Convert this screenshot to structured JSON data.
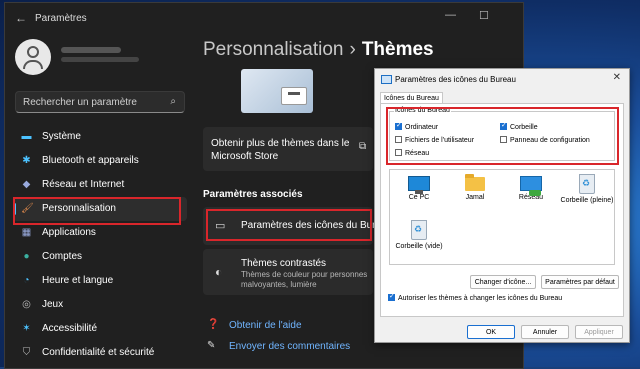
{
  "settings": {
    "app_title": "Paramètres",
    "search_placeholder": "Rechercher un paramètre",
    "nav": [
      {
        "label": "Système",
        "icon": "monitor-icon",
        "color": "#4cc2ff"
      },
      {
        "label": "Bluetooth et appareils",
        "icon": "bluetooth-icon",
        "color": "#4cc2ff"
      },
      {
        "label": "Réseau et Internet",
        "icon": "wifi-icon",
        "color": "#9ad"
      },
      {
        "label": "Personnalisation",
        "icon": "brush-icon",
        "color": "#e08a4c",
        "active": true
      },
      {
        "label": "Applications",
        "icon": "apps-icon",
        "color": "#9ad"
      },
      {
        "label": "Comptes",
        "icon": "person-icon",
        "color": "#3bb0a0"
      },
      {
        "label": "Heure et langue",
        "icon": "globe-icon",
        "color": "#4cc2ff"
      },
      {
        "label": "Jeux",
        "icon": "gamepad-icon",
        "color": "#bbb"
      },
      {
        "label": "Accessibilité",
        "icon": "accessibility-icon",
        "color": "#4cc2ff"
      },
      {
        "label": "Confidentialité et sécurité",
        "icon": "shield-icon",
        "color": "#bbb"
      }
    ],
    "breadcrumb_parent": "Personnalisation",
    "breadcrumb_sep": "›",
    "breadcrumb_current": "Thèmes",
    "store_card_text": "Obtenir plus de thèmes dans le Microsoft Store",
    "related_title": "Paramètres associés",
    "desktop_icons_label": "Paramètres des icônes du Bureau",
    "contrast_title": "Thèmes contrastés",
    "contrast_sub": "Thèmes de couleur pour personnes malvoyantes, lumière",
    "help_link": "Obtenir de l'aide",
    "feedback_link": "Envoyer des commentaires"
  },
  "dialog": {
    "title": "Paramètres des icônes du Bureau",
    "close": "✕",
    "tab": "Icônes du Bureau",
    "group_label": "Icônes du Bureau",
    "checkboxes": [
      {
        "label": "Ordinateur",
        "checked": true
      },
      {
        "label": "Corbeille",
        "checked": true
      },
      {
        "label": "Fichiers de l'utilisateur",
        "checked": false
      },
      {
        "label": "Panneau de configuration",
        "checked": false
      },
      {
        "label": "Réseau",
        "checked": false
      }
    ],
    "icons": [
      {
        "label": "Ce PC",
        "kind": "pc"
      },
      {
        "label": "Jamal",
        "kind": "folder"
      },
      {
        "label": "Réseau",
        "kind": "net"
      },
      {
        "label": "Corbeille (pleine)",
        "kind": "bin"
      },
      {
        "label": "Corbeille (vide)",
        "kind": "bin"
      }
    ],
    "change_icon": "Changer d'icône...",
    "default_params": "Paramètres par défaut",
    "allow_themes": "Autoriser les thèmes à changer les icônes du Bureau",
    "allow_themes_checked": true,
    "ok": "OK",
    "cancel": "Annuler",
    "apply": "Appliquer"
  }
}
